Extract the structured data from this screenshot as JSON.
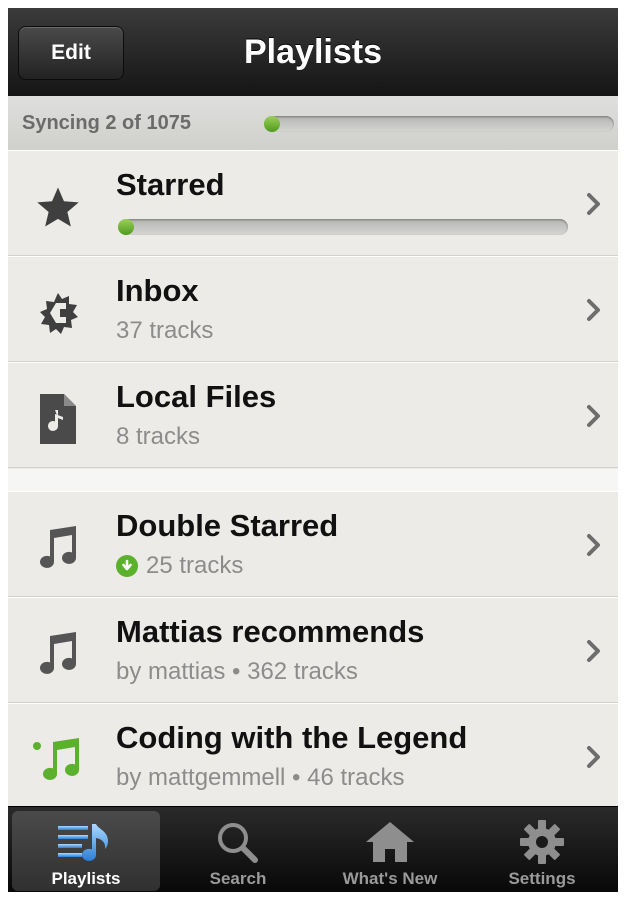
{
  "navbar": {
    "edit_label": "Edit",
    "title": "Playlists"
  },
  "sync": {
    "text": "Syncing 2 of 1075",
    "progress": 0.0019
  },
  "playlists": [
    {
      "title": "Starred",
      "icon": "star-icon",
      "progress": 0.02
    },
    {
      "title": "Inbox",
      "subtitle": "37 tracks",
      "icon": "inbox-icon"
    },
    {
      "title": "Local Files",
      "subtitle": "8 tracks",
      "icon": "local-file-icon"
    },
    {
      "title": "Double Starred",
      "subtitle": "25 tracks",
      "icon": "music-note-icon",
      "downloaded": true
    },
    {
      "title": "Mattias recommends",
      "subtitle": "by mattias • 362 tracks",
      "icon": "music-note-icon"
    },
    {
      "title": "Coding with the Legend",
      "subtitle": "by mattgemmell • 46 tracks",
      "icon": "music-note-new-icon"
    }
  ],
  "tabs": [
    {
      "label": "Playlists",
      "icon": "playlists-icon",
      "active": true
    },
    {
      "label": "Search",
      "icon": "search-icon"
    },
    {
      "label": "What's New",
      "icon": "home-icon"
    },
    {
      "label": "Settings",
      "icon": "gear-icon"
    }
  ],
  "colors": {
    "accent_green": "#5bb02c",
    "nav_dark": "#1a1a1a",
    "active_tab_blue": "#4ea3e8"
  }
}
